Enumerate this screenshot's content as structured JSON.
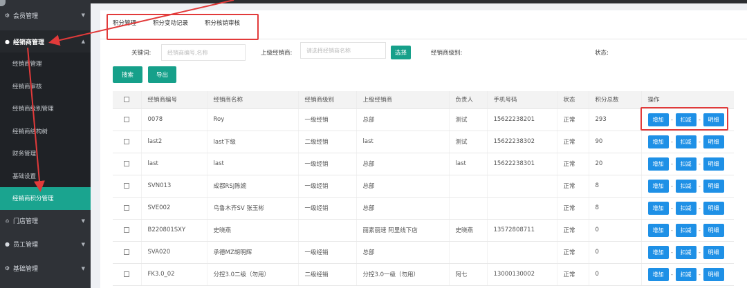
{
  "sidebar": {
    "groups": [
      {
        "label": "会员管理",
        "icon": "gear-icon",
        "caret": "▼"
      },
      {
        "label": "经销商管理",
        "icon": "user-icon",
        "caret": "▲"
      },
      {
        "label": "门店管理",
        "icon": "home-icon",
        "caret": "▼"
      },
      {
        "label": "员工管理",
        "icon": "person-icon",
        "caret": "▼"
      },
      {
        "label": "基础管理",
        "icon": "gear-icon",
        "caret": "▼"
      }
    ],
    "sub_items": [
      "经销商管理",
      "经销商审核",
      "经销商级别管理",
      "经销商结构树",
      "财务管理",
      "基础设置",
      "经销商积分管理"
    ],
    "active_sub": "经销商积分管理"
  },
  "tabs": [
    "积分管理",
    "积分变动记录",
    "积分核销审核"
  ],
  "filters": {
    "keyword_label": "关键词:",
    "keyword_placeholder": "经销商编号,名称",
    "parent_label": "上级经销商:",
    "parent_placeholder": "请选择经销商名称",
    "select_btn": "选择",
    "level_label": "经销商级别:",
    "status_label": "状态:"
  },
  "actions": {
    "search": "搜索",
    "export": "导出"
  },
  "table": {
    "headers": [
      "",
      "经销商编号",
      "经销商名称",
      "经销商级别",
      "上级经销商",
      "负责人",
      "手机号码",
      "状态",
      "积分总数",
      "操作"
    ],
    "rows": [
      [
        "0078",
        "Roy",
        "一级经销",
        "总部",
        "测试",
        "15622238201",
        "正常",
        "293"
      ],
      [
        "last2",
        "last下级",
        "二级经销",
        "last",
        "测试",
        "15622238302",
        "正常",
        "90"
      ],
      [
        "last",
        "last",
        "一级经销",
        "总部",
        "last",
        "15622238301",
        "正常",
        "20"
      ],
      [
        "SVN013",
        "成都RSJ陈婉",
        "一级经销",
        "总部",
        "",
        "",
        "正常",
        "8"
      ],
      [
        "SVE002",
        "乌鲁木齐SV 张玉彬",
        "一级经销",
        "总部",
        "",
        "",
        "正常",
        "8"
      ],
      [
        "B220801SXY",
        "史晓燕",
        "",
        "丽素丽速 阿里线下店",
        "史晓燕",
        "13572808711",
        "正常",
        "0"
      ],
      [
        "SVA020",
        "承德MZ胡明辉",
        "一级经销",
        "总部",
        "",
        "",
        "正常",
        "0"
      ],
      [
        "FK3.0_02",
        "分控3.0二级（勿用）",
        "二级经销",
        "分控3.0一级（勿用）",
        "阿七",
        "13000130002",
        "正常",
        "0"
      ]
    ],
    "op_labels": {
      "add": "增加",
      "sep": "-",
      "deduct": "扣减",
      "detail": "明细"
    }
  },
  "colors": {
    "sidebar_bg": "#2f3237",
    "active_green": "#1aa48f",
    "btn_green": "#16a08a",
    "op_blue": "#1e90e6",
    "annotation_red": "#e23a3a"
  }
}
